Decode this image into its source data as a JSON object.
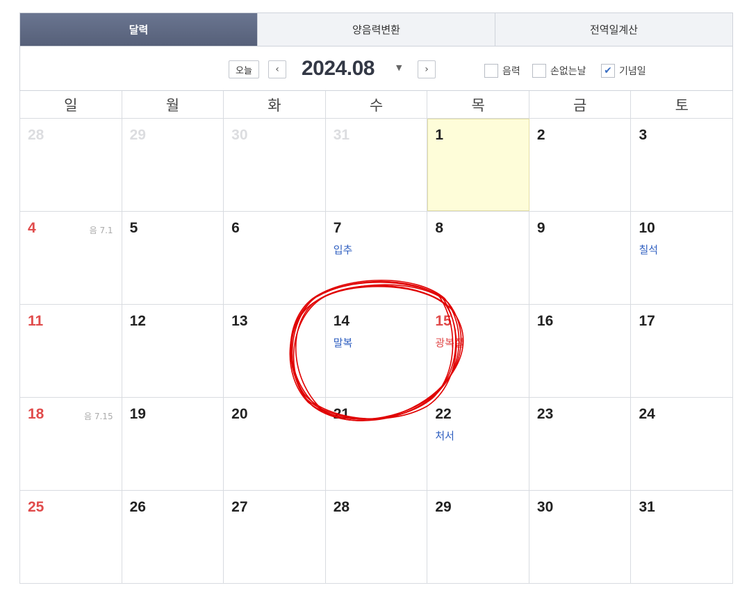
{
  "tabs": [
    {
      "label": "달력",
      "active": true
    },
    {
      "label": "양음력변환",
      "active": false
    },
    {
      "label": "전역일계산",
      "active": false
    }
  ],
  "toolbar": {
    "today_label": "오늘",
    "prev_icon": "‹",
    "next_icon": "›",
    "month": "2024.08",
    "caret": "▼",
    "options": {
      "lunar": {
        "label": "음력",
        "checked": false
      },
      "sonup": {
        "label": "손없는날",
        "checked": false
      },
      "anniv": {
        "label": "기념일",
        "checked": true,
        "check_glyph": "✔"
      }
    }
  },
  "weekdays": [
    "일",
    "월",
    "화",
    "수",
    "목",
    "금",
    "토"
  ],
  "weeks": [
    [
      {
        "num": "28",
        "other": true
      },
      {
        "num": "29",
        "other": true
      },
      {
        "num": "30",
        "other": true
      },
      {
        "num": "31",
        "other": true
      },
      {
        "num": "1",
        "today": true
      },
      {
        "num": "2"
      },
      {
        "num": "3"
      }
    ],
    [
      {
        "num": "4",
        "lunar": "음 7.1"
      },
      {
        "num": "5"
      },
      {
        "num": "6"
      },
      {
        "num": "7",
        "event": "입추"
      },
      {
        "num": "8"
      },
      {
        "num": "9"
      },
      {
        "num": "10",
        "event": "칠석"
      }
    ],
    [
      {
        "num": "11"
      },
      {
        "num": "12"
      },
      {
        "num": "13"
      },
      {
        "num": "14",
        "event": "말복"
      },
      {
        "num": "15",
        "event": "광복절",
        "holiday": true
      },
      {
        "num": "16"
      },
      {
        "num": "17"
      }
    ],
    [
      {
        "num": "18",
        "lunar": "음 7.15"
      },
      {
        "num": "19"
      },
      {
        "num": "20"
      },
      {
        "num": "21"
      },
      {
        "num": "22",
        "event": "처서"
      },
      {
        "num": "23"
      },
      {
        "num": "24"
      }
    ],
    [
      {
        "num": "25"
      },
      {
        "num": "26"
      },
      {
        "num": "27"
      },
      {
        "num": "28"
      },
      {
        "num": "29"
      },
      {
        "num": "30"
      },
      {
        "num": "31"
      }
    ]
  ],
  "colors": {
    "sunday": "#e04b4b",
    "holiday": "#e04b4b",
    "event": "#2f5fc0",
    "today_bg": "#fefdd9",
    "active_tab": "#5f6984",
    "annotation": "#e00000"
  }
}
